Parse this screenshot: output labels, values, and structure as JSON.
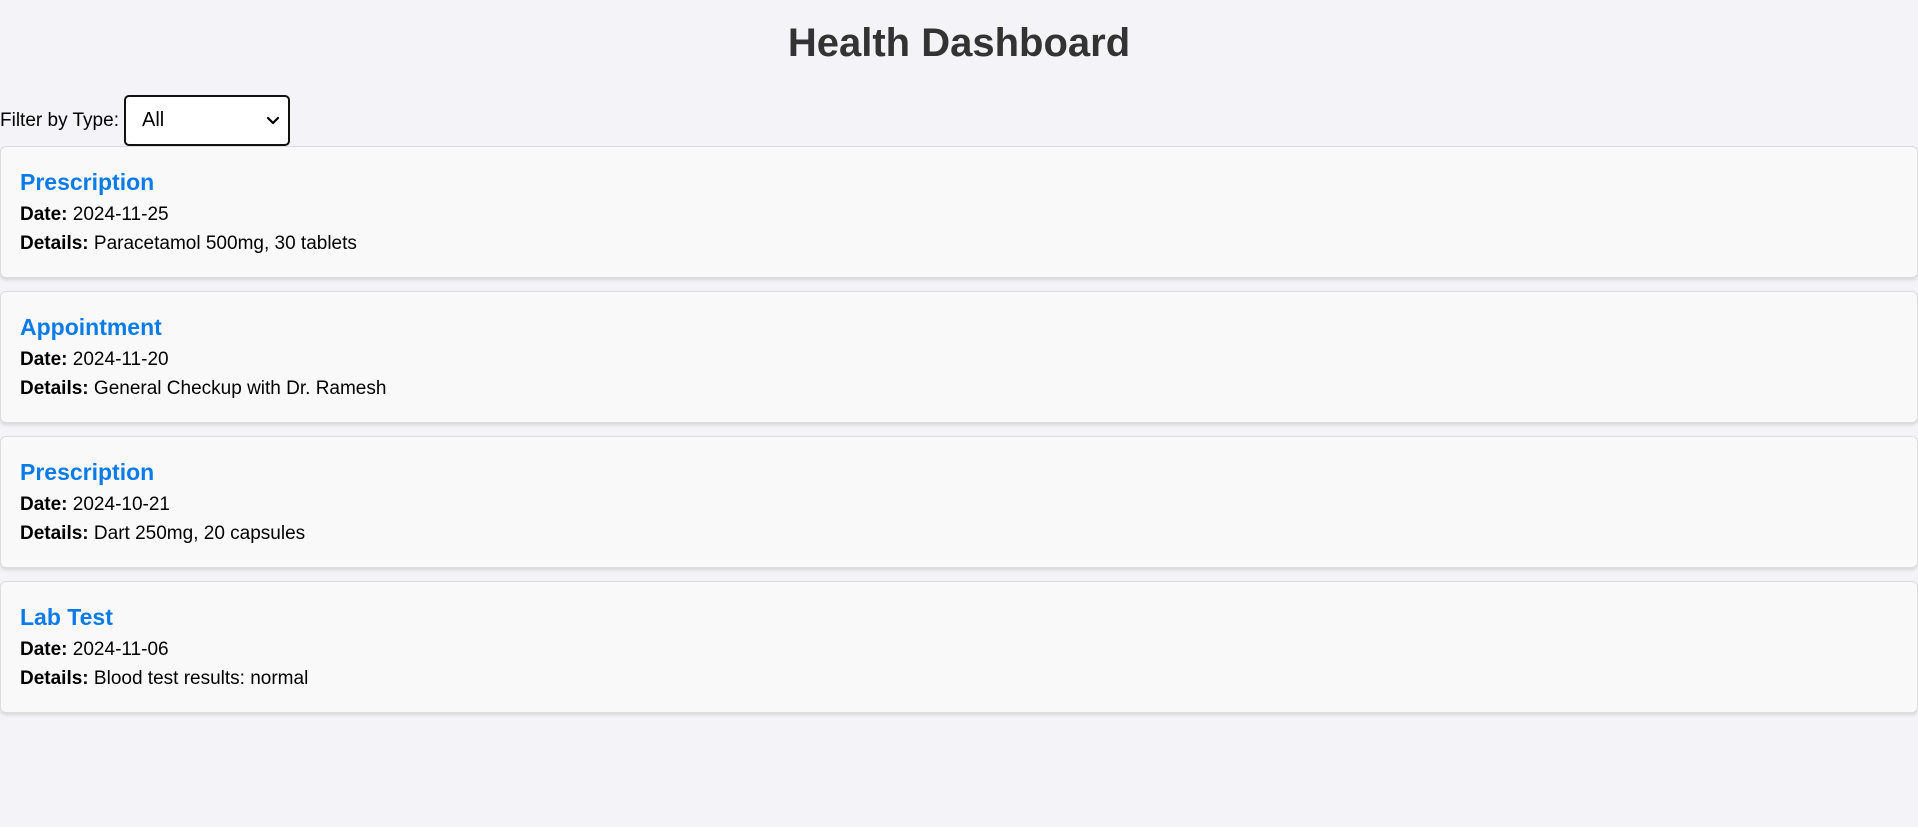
{
  "header": {
    "title": "Health Dashboard"
  },
  "filter": {
    "label": "Filter by Type:",
    "selected": "All"
  },
  "record_field_labels": {
    "date": "Date:",
    "details": "Details:"
  },
  "records": [
    {
      "type": "Prescription",
      "date": "2024-11-25",
      "details": "Paracetamol 500mg, 30 tablets"
    },
    {
      "type": "Appointment",
      "date": "2024-11-20",
      "details": "General Checkup with Dr. Ramesh"
    },
    {
      "type": "Prescription",
      "date": "2024-10-21",
      "details": "Dart 250mg, 20 capsules"
    },
    {
      "type": "Lab Test",
      "date": "2024-11-06",
      "details": "Blood test results: normal"
    }
  ],
  "colors": {
    "background": "#f4f4f8",
    "title": "#333333",
    "record_type": "#0a7be8",
    "card_background": "#f9f9f9"
  }
}
